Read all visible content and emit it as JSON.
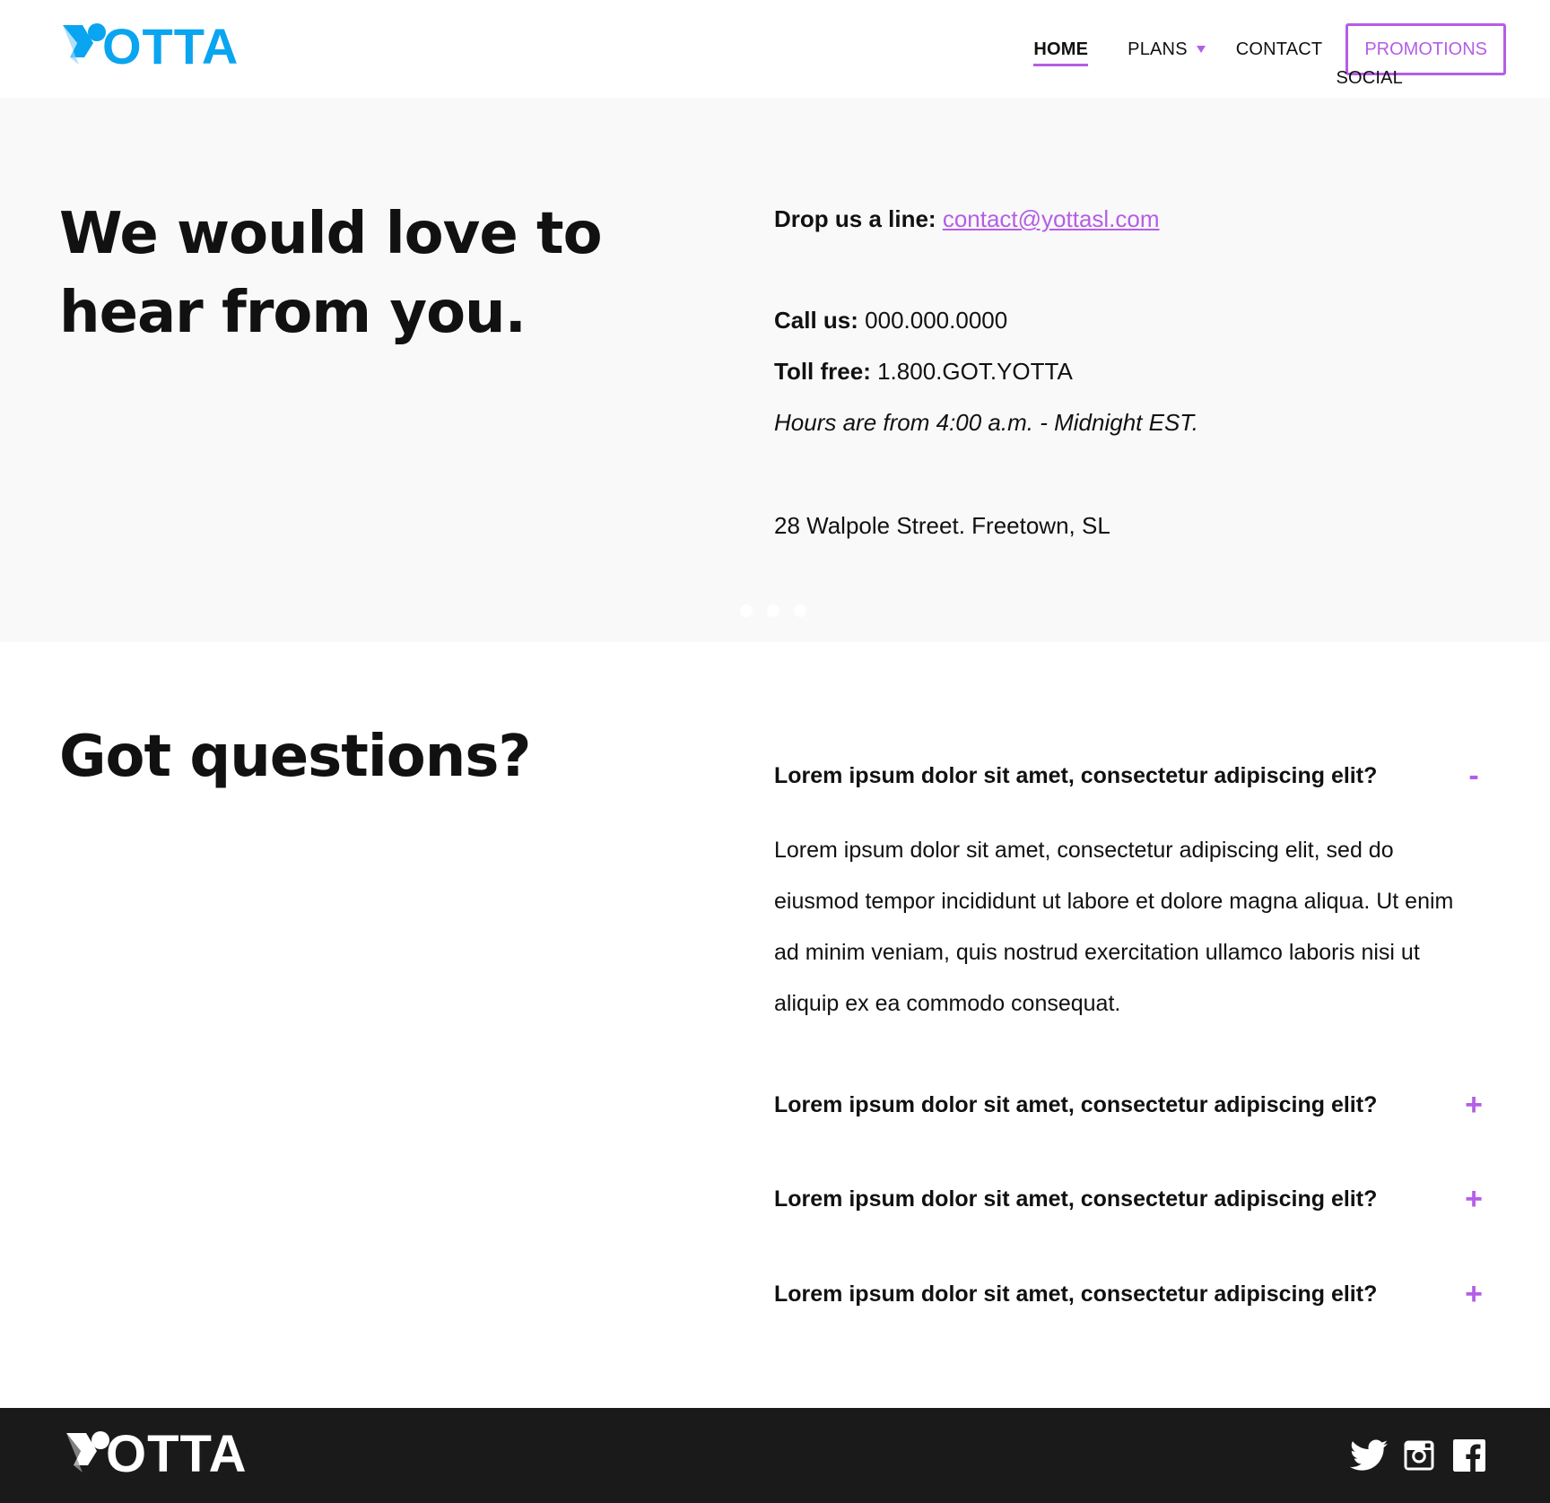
{
  "brand": {
    "name": "OTTA",
    "accent": "#b45ee6",
    "logo_color": "#0aa5f0"
  },
  "nav": {
    "items": [
      {
        "label": "HOME"
      },
      {
        "label": "PLANS"
      },
      {
        "label": "SOCIAL"
      },
      {
        "label": "CONTACT"
      }
    ],
    "promo_label": "PROMOTIONS"
  },
  "hero": {
    "title": "We would love to hear from you.",
    "email_label": "Drop us a line:",
    "email": "contact@yottasl.com",
    "call_label": "Call us:",
    "call_value": "000.000.0000",
    "tollfree_label": "Toll free:",
    "tollfree_value": "1.800.GOT.YOTTA",
    "hours": "Hours are from 4:00 a.m. - Midnight EST.",
    "address": "28 Walpole Street. Freetown, SL",
    "carousel_dots": 3
  },
  "faq": {
    "title": "Got questions?",
    "items": [
      {
        "question": "Lorem ipsum dolor sit amet, consectetur adipiscing elit?",
        "toggle": "-",
        "expanded": true,
        "answer": "Lorem ipsum dolor sit amet, consectetur adipiscing elit, sed do eiusmod tempor incididunt ut labore et dolore magna aliqua. Ut enim ad minim veniam, quis nostrud exercitation ullamco laboris nisi ut aliquip ex ea commodo consequat."
      },
      {
        "question": "Lorem ipsum dolor sit amet, consectetur adipiscing elit?",
        "toggle": "+",
        "expanded": false
      },
      {
        "question": "Lorem ipsum dolor sit amet, consectetur adipiscing elit?",
        "toggle": "+",
        "expanded": false
      },
      {
        "question": "Lorem ipsum dolor sit amet, consectetur adipiscing elit?",
        "toggle": "+",
        "expanded": false
      }
    ]
  },
  "footer": {
    "brand": "OTTA",
    "social": [
      "twitter-icon",
      "instagram-icon",
      "facebook-icon"
    ]
  }
}
